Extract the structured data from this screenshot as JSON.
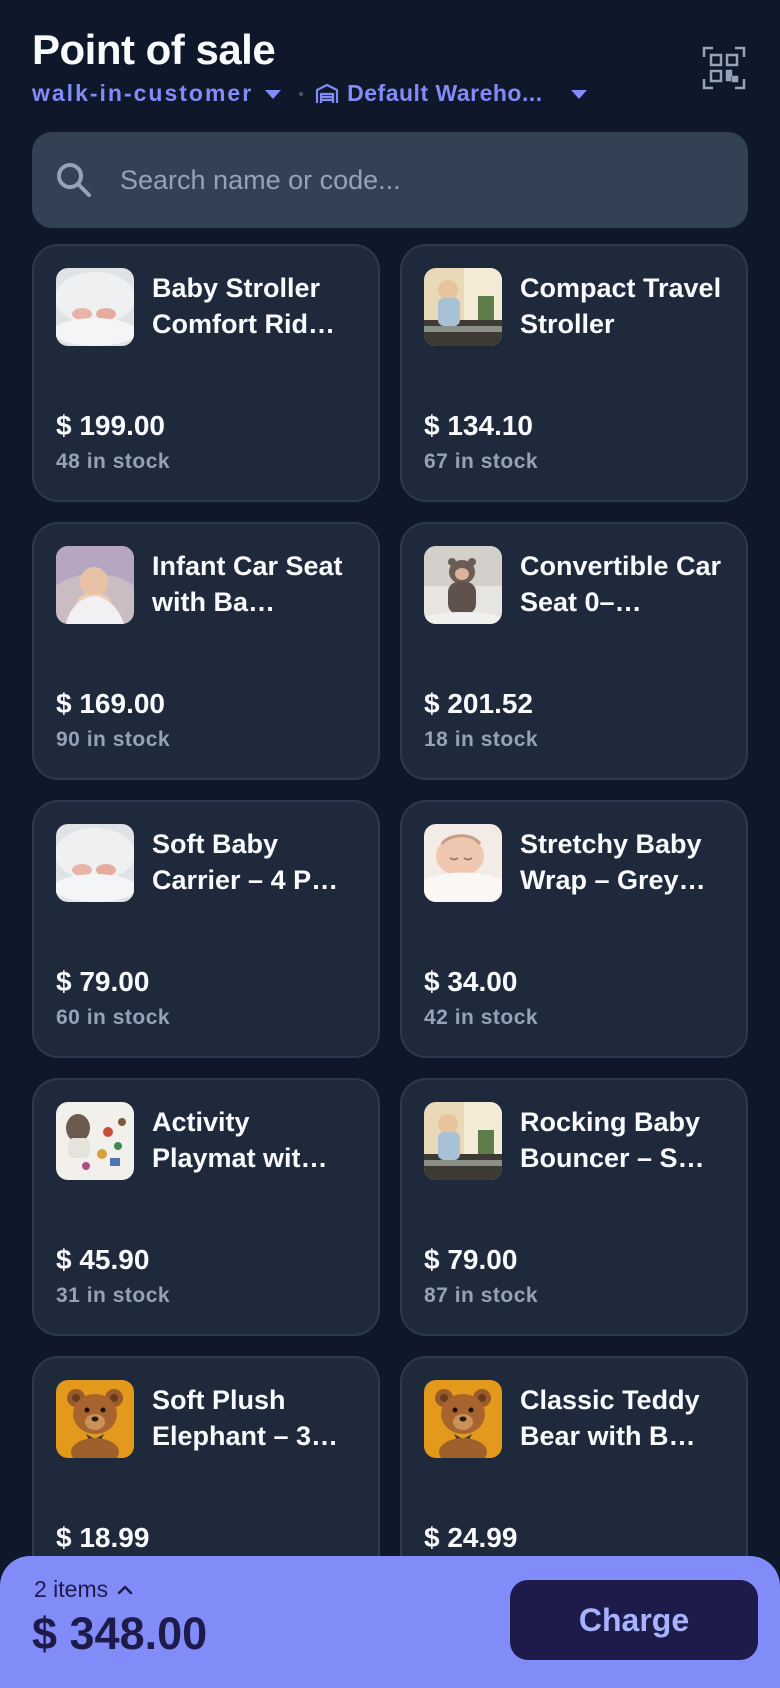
{
  "header": {
    "title": "Point of sale",
    "customer": "walk-in-customer",
    "warehouse": "Default Wareho..."
  },
  "search": {
    "placeholder": "Search name or code..."
  },
  "products": [
    {
      "name": "Baby Stroller Comfort Rid…",
      "price": "$ 199.00",
      "stock": "48 in stock",
      "image": "baby-feet-photo"
    },
    {
      "name": "Compact Travel Stroller",
      "price": "$ 134.10",
      "stock": "67 in stock",
      "image": "toddler-window-photo"
    },
    {
      "name": "Infant Car Seat with Ba…",
      "price": "$ 169.00",
      "stock": "90 in stock",
      "image": "baby-towel-photo"
    },
    {
      "name": "Convertible Car Seat 0–…",
      "price": "$ 201.52",
      "stock": "18 in stock",
      "image": "baby-bear-costume-photo"
    },
    {
      "name": "Soft Baby Carrier – 4 P…",
      "price": "$ 79.00",
      "stock": "60 in stock",
      "image": "baby-feet-photo"
    },
    {
      "name": "Stretchy Baby Wrap – Grey…",
      "price": "$ 34.00",
      "stock": "42 in stock",
      "image": "sleeping-baby-photo"
    },
    {
      "name": "Activity Playmat wit…",
      "price": "$ 45.90",
      "stock": "31 in stock",
      "image": "toys-floor-photo"
    },
    {
      "name": "Rocking Baby Bouncer – S…",
      "price": "$ 79.00",
      "stock": "87 in stock",
      "image": "toddler-window-photo"
    },
    {
      "name": "Soft Plush Elephant – 3…",
      "price": "$ 18.99",
      "stock": "",
      "image": "teddy-bear-photo"
    },
    {
      "name": "Classic Teddy Bear with B…",
      "price": "$ 24.99",
      "stock": "",
      "image": "teddy-bear-photo"
    }
  ],
  "cart": {
    "items_label": "2 items",
    "total": "$ 348.00",
    "charge_label": "Charge"
  },
  "colors": {
    "background": "#0f172a",
    "card": "#1e293b",
    "accent": "#818cf8",
    "charge_button": "#1e1b4b"
  },
  "icons": [
    "warehouse-icon",
    "chevron-down-icon",
    "qr-scan-icon",
    "search-icon",
    "chevron-up-icon"
  ]
}
